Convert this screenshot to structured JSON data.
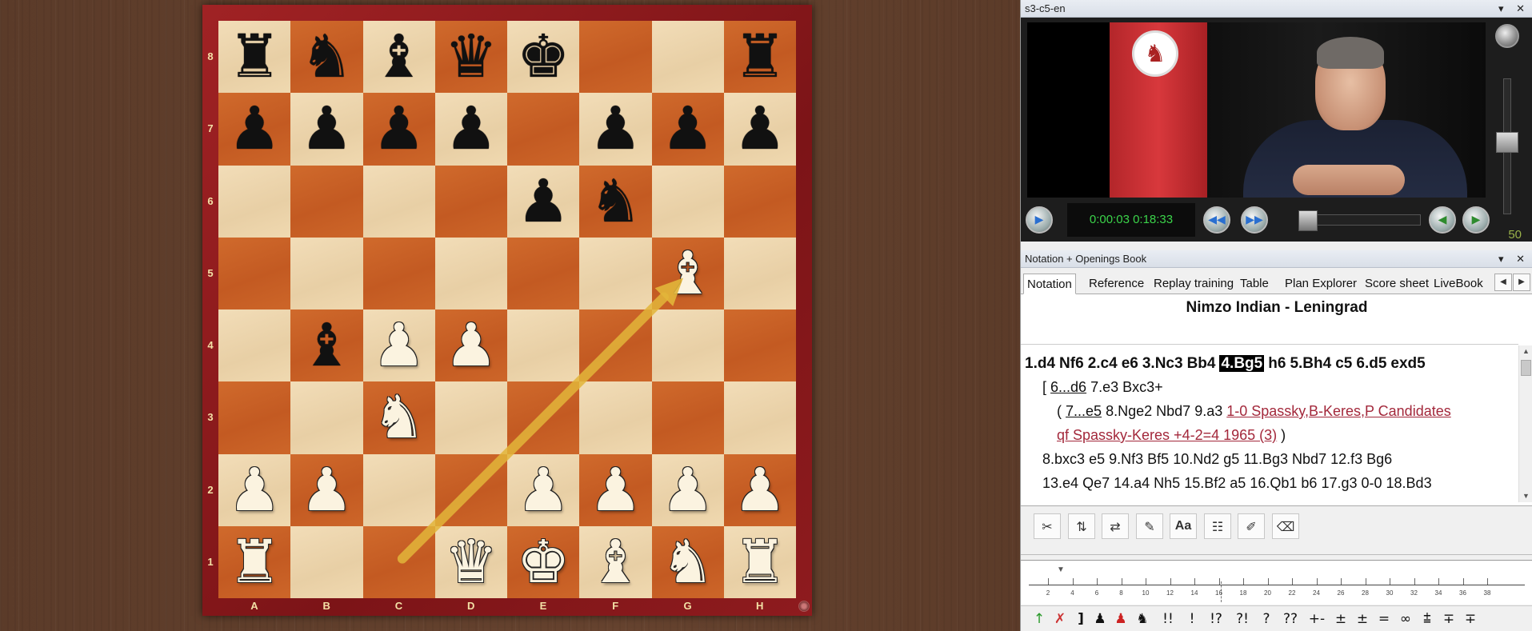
{
  "board": {
    "ranks": [
      "8",
      "7",
      "6",
      "5",
      "4",
      "3",
      "2",
      "1"
    ],
    "files": [
      "A",
      "B",
      "C",
      "D",
      "E",
      "F",
      "G",
      "H"
    ],
    "position": [
      [
        "br",
        "bn",
        "bb",
        "bq",
        "bk",
        "",
        "",
        "br"
      ],
      [
        "bp",
        "bp",
        "bp",
        "bp",
        "",
        "bp",
        "bp",
        "bp"
      ],
      [
        "",
        "",
        "",
        "",
        "bp",
        "bn",
        "",
        ""
      ],
      [
        "",
        "",
        "",
        "",
        "",
        "",
        "wb",
        ""
      ],
      [
        "",
        "bb",
        "wp",
        "wp",
        "",
        "",
        "",
        ""
      ],
      [
        "",
        "",
        "wn",
        "",
        "",
        "",
        "",
        ""
      ],
      [
        "wp",
        "wp",
        "",
        "",
        "wp",
        "wp",
        "wp",
        "wp"
      ],
      [
        "wr",
        "",
        "",
        "wq",
        "wk",
        "wb",
        "wn",
        "wr"
      ]
    ],
    "arrow": {
      "from": "c1",
      "to": "g5",
      "color": "#e2b53a"
    }
  },
  "video": {
    "title": "s3-c5-en",
    "time": "0:00:03 0:18:33",
    "volume": "50",
    "progress": 0.003
  },
  "notation_pane": {
    "title": "Notation + Openings Book",
    "tabs": [
      "Notation",
      "Reference",
      "Replay training",
      "Table",
      "Plan Explorer",
      "Score sheet",
      "LiveBook"
    ],
    "opening": "Nimzo Indian - Leningrad",
    "line1": [
      "1.d4",
      "Nf6",
      "2.c4",
      "e6",
      "3.Nc3",
      "Bb4",
      "4.Bg5",
      "h6",
      "5.Bh4",
      "c5",
      "6.d5",
      "exd5"
    ],
    "line2_open": "[",
    "line2": [
      "6...d6",
      "7.e3",
      "Bxc3+"
    ],
    "line3_open": "(",
    "line3": [
      "7...e5",
      "8.Nge2",
      "Nbd7",
      "9.a3"
    ],
    "game_link_1": "1-0 Spassky,B-Keres,P Candidates",
    "game_link_2": "qf Spassky-Keres +4-2=4 1965 (3)",
    "line4_close": ")",
    "line5": [
      "8.bxc3",
      "e5",
      "9.Nf3",
      "Bf5",
      "10.Nd2",
      "g5",
      "11.Bg3",
      "Nbd7",
      "12.f3",
      "Bg6"
    ],
    "line6": [
      "13.e4",
      "Qe7",
      "14.a4",
      "Nh5",
      "15.Bf2",
      "a5",
      "16.Qb1",
      "b6",
      "17.g3",
      "0-0",
      "18.Bd3"
    ]
  },
  "timeline": {
    "ticks": [
      "2",
      "4",
      "6",
      "8",
      "10",
      "12",
      "14",
      "16",
      "18",
      "20",
      "22",
      "24",
      "26",
      "28",
      "30",
      "32",
      "34",
      "36",
      "38"
    ]
  },
  "symbols": [
    "!!",
    "!",
    "!?",
    "?!",
    "?",
    "??",
    "+-",
    "±",
    "±",
    "=",
    "∞",
    "⩲",
    "∓",
    "∓"
  ],
  "icons": {
    "pieces": {
      "k": "♚",
      "q": "♛",
      "r": "♜",
      "b": "♝",
      "n": "♞",
      "p": "♟"
    }
  }
}
